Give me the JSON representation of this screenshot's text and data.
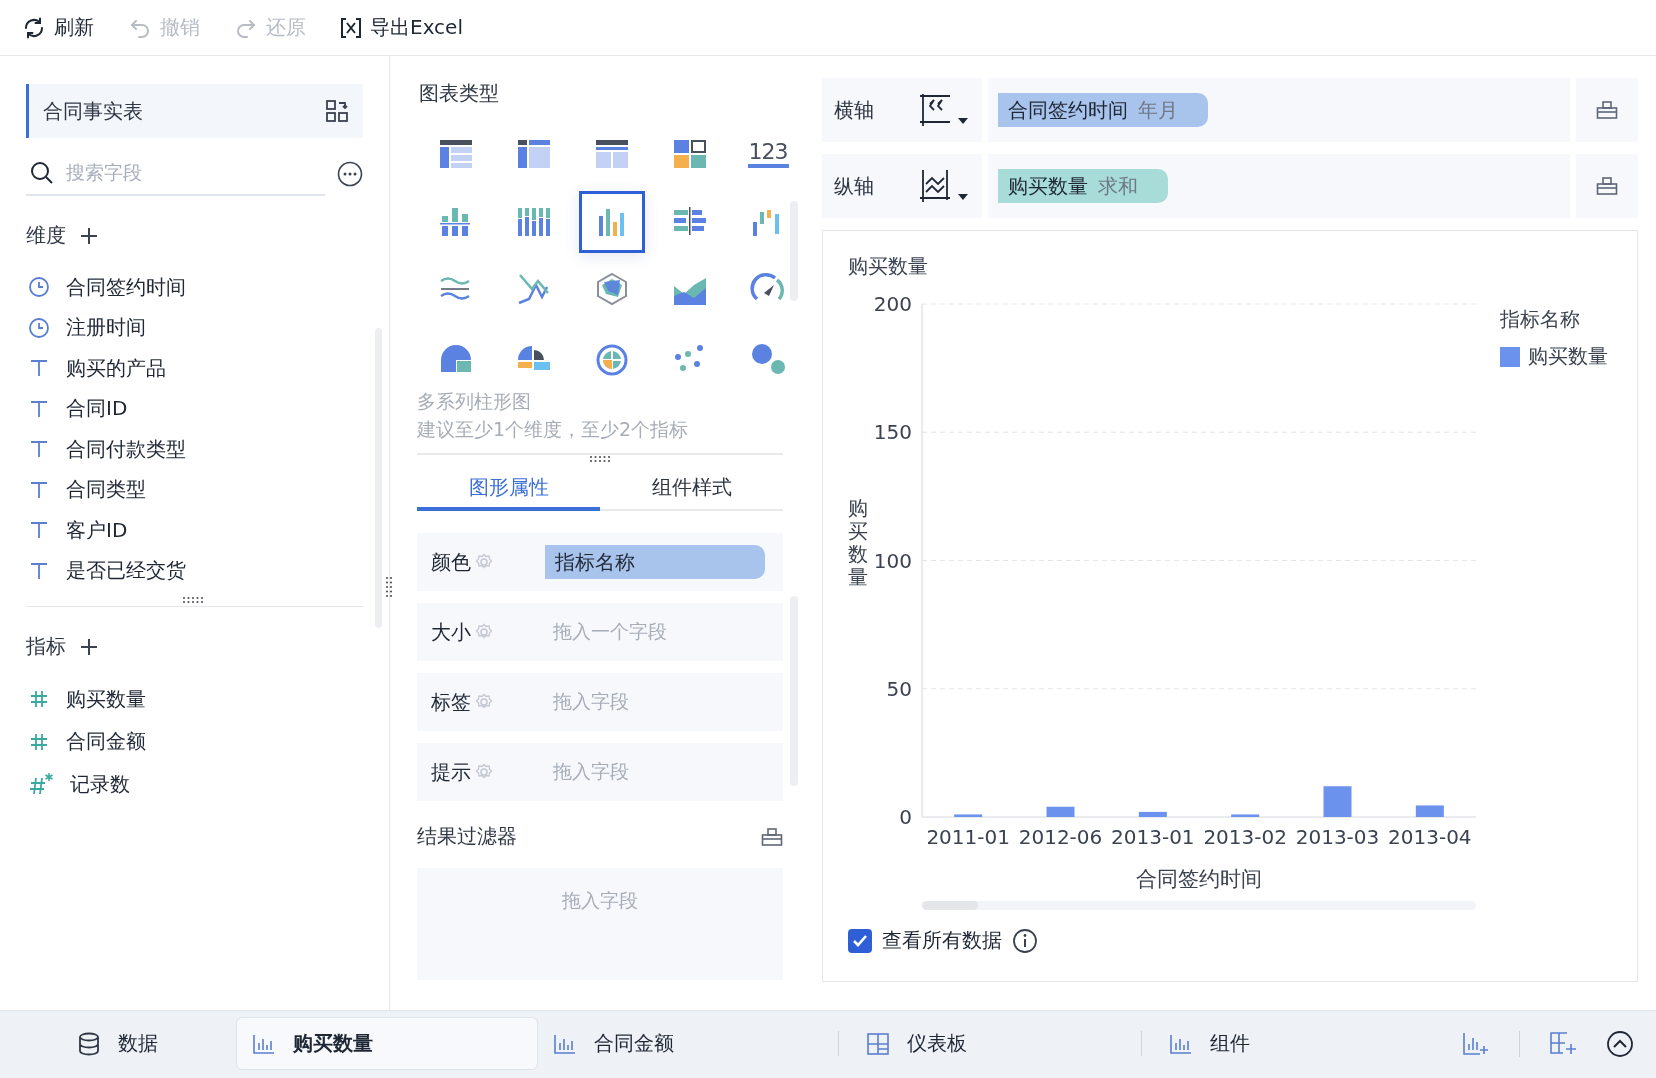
{
  "toolbar": [
    {
      "kind": "refresh",
      "label": "刷新",
      "disabled": false
    },
    {
      "kind": "undo",
      "label": "撤销",
      "disabled": true
    },
    {
      "kind": "redo",
      "label": "还原",
      "disabled": true
    },
    {
      "kind": "export",
      "label": "导出Excel",
      "disabled": false
    }
  ],
  "data_panel": {
    "table": "合同事实表",
    "search": {
      "placeholder": "搜索字段"
    },
    "dimensions": {
      "title": "维度",
      "fields": [
        {
          "kind": "time",
          "label": "合同签约时间"
        },
        {
          "kind": "time",
          "label": "注册时间"
        },
        {
          "kind": "text",
          "label": "购买的产品"
        },
        {
          "kind": "text",
          "label": "合同ID"
        },
        {
          "kind": "text",
          "label": "合同付款类型"
        },
        {
          "kind": "text",
          "label": "合同类型"
        },
        {
          "kind": "text",
          "label": "客户ID"
        },
        {
          "kind": "text",
          "label": "是否已经交货"
        }
      ]
    },
    "measures": {
      "title": "指标",
      "fields": [
        {
          "kind": "number",
          "label": "购买数量"
        },
        {
          "kind": "number",
          "label": "合同金额"
        },
        {
          "kind": "count",
          "label": "记录数"
        }
      ]
    }
  },
  "chart_types": {
    "title": "图表类型",
    "items": [
      {
        "kind": "table",
        "selected": false
      },
      {
        "kind": "cross_table",
        "selected": false
      },
      {
        "kind": "detail_table",
        "selected": false
      },
      {
        "kind": "treemap",
        "selected": false
      },
      {
        "kind": "number",
        "label": "123",
        "selected": false
      },
      {
        "kind": "stacked_bar",
        "selected": false
      },
      {
        "kind": "grouped_bar",
        "selected": false
      },
      {
        "kind": "multi_bar",
        "selected": true
      },
      {
        "kind": "horizontal_bar",
        "selected": false
      },
      {
        "kind": "range_bar",
        "selected": false
      },
      {
        "kind": "stream",
        "selected": false
      },
      {
        "kind": "line",
        "selected": false
      },
      {
        "kind": "radar",
        "selected": false
      },
      {
        "kind": "area",
        "selected": false
      },
      {
        "kind": "gauge",
        "selected": false
      },
      {
        "kind": "pie",
        "selected": false
      },
      {
        "kind": "rose",
        "selected": false
      },
      {
        "kind": "sunburst",
        "selected": false
      },
      {
        "kind": "scatter",
        "selected": false
      },
      {
        "kind": "bubble",
        "selected": false
      }
    ],
    "name": "多系列柱形图",
    "hint": "建议至少1个维度，至少2个指标"
  },
  "property_tabs": [
    {
      "label": "图形属性",
      "selected": true
    },
    {
      "label": "组件样式",
      "selected": false
    }
  ],
  "properties": [
    {
      "label": "颜色",
      "field": "指标名称"
    },
    {
      "label": "大小",
      "placeholder": "拖入一个字段"
    },
    {
      "label": "标签",
      "placeholder": "拖入字段"
    },
    {
      "label": "提示",
      "placeholder": "拖入字段"
    }
  ],
  "result_filter": {
    "title": "结果过滤器",
    "placeholder": "拖入字段"
  },
  "axes": [
    {
      "kind": "dimension",
      "label": "横轴",
      "field": "合同签约时间",
      "aggregation": "年月"
    },
    {
      "kind": "measure",
      "label": "纵轴",
      "field": "购买数量",
      "aggregation": "求和"
    }
  ],
  "chart": {
    "title": "购买数量",
    "legend_title": "指标名称",
    "show_all": {
      "label": "查看所有数据",
      "checked": true
    },
    "chart_data": {
      "type": "bar",
      "xlabel": "合同签约时间",
      "ylabel": "购买数量",
      "categories": [
        "2011-01",
        "2012-06",
        "2013-01",
        "2013-02",
        "2013-03",
        "2013-04"
      ],
      "series": [
        {
          "name": "购买数量",
          "color": "#6b93ee",
          "values": [
            1,
            4,
            2,
            1,
            12,
            4.5
          ]
        }
      ],
      "ylim": [
        0,
        200
      ],
      "yticks": [
        0,
        50,
        100,
        150,
        200
      ],
      "grid": true
    }
  },
  "bottom_tabs": [
    {
      "kind": "data",
      "label": "数据",
      "selected": false
    },
    {
      "kind": "chart",
      "label": "购买数量",
      "selected": true
    },
    {
      "kind": "chart",
      "label": "合同金额",
      "selected": false
    },
    {
      "kind": "dashboard",
      "label": "仪表板",
      "selected": false
    },
    {
      "kind": "chart",
      "label": "组件",
      "selected": false
    }
  ]
}
